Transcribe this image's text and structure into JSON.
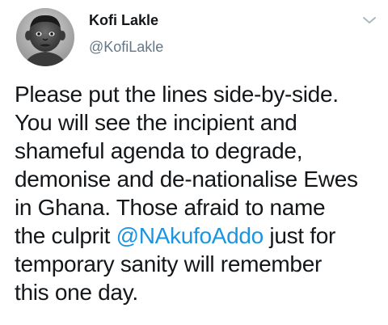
{
  "author": {
    "name": "Kofi Lakle",
    "handle": "@KofiLakle"
  },
  "icons": {
    "avatar": "child-portrait-avatar",
    "menu": "chevron-down-icon"
  },
  "colors": {
    "text": "#14171a",
    "secondary": "#657786",
    "link": "#1b95e0"
  },
  "tweet": {
    "line1": "Please put the lines side-by-side.",
    "line2": "You will see the incipient and",
    "line3": "shameful agenda to degrade,",
    "line4": "demonise and de-nationalise Ewes",
    "line5": "in Ghana. Those afraid to name",
    "line6_before": "the culprit ",
    "line6_mention": "@NAkufoAddo",
    "line6_after": " just for",
    "line7": "temporary sanity will remember",
    "line8": "this one day."
  }
}
